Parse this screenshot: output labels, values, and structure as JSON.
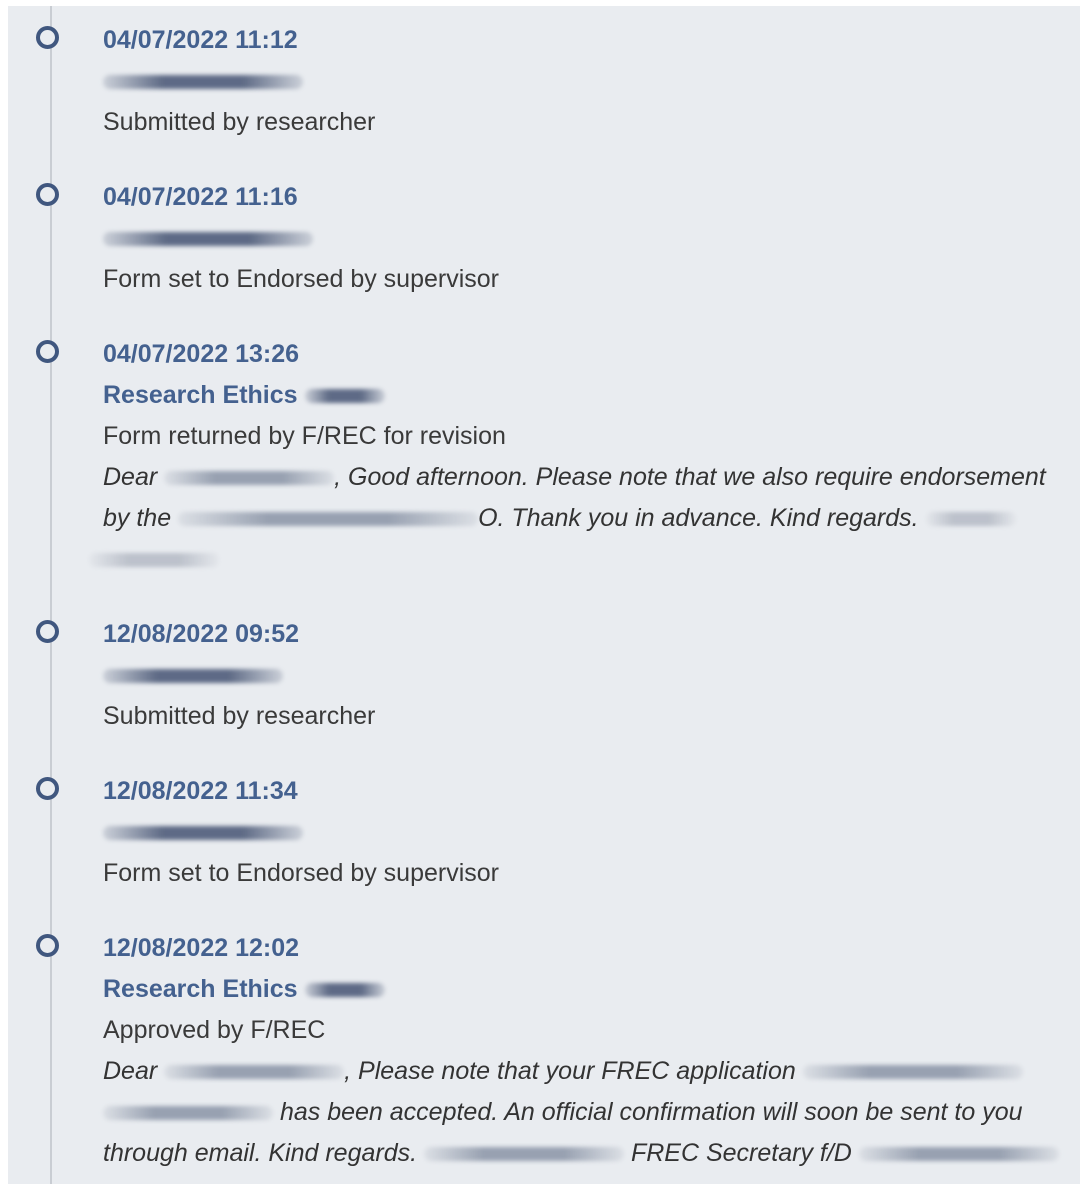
{
  "timeline": {
    "entries": [
      {
        "timestamp": "04/07/2022 11:12",
        "status": "Submitted by researcher"
      },
      {
        "timestamp": "04/07/2022 11:16",
        "status": "Form set to Endorsed by supervisor"
      },
      {
        "timestamp": "04/07/2022 13:26",
        "author": "Research Ethics",
        "status": "Form returned by F/REC for revision",
        "message": {
          "p1": "Dear",
          "p2": ", Good afternoon. Please note that we also require endorsement",
          "p3": "by the",
          "p4": "O. Thank you in advance. Kind regards."
        }
      },
      {
        "timestamp": "12/08/2022 09:52",
        "status": "Submitted by researcher"
      },
      {
        "timestamp": "12/08/2022 11:34",
        "status": "Form set to Endorsed by supervisor"
      },
      {
        "timestamp": "12/08/2022 12:02",
        "author": "Research Ethics",
        "status": "Approved by F/REC",
        "message": {
          "p1": "Dear",
          "p2": ", Please note that your FREC application",
          "p3": "has been accepted. An official confirmation will soon be sent to you",
          "p4": "through email. Kind regards.",
          "p5": "FREC Secretary f/D"
        }
      }
    ]
  }
}
